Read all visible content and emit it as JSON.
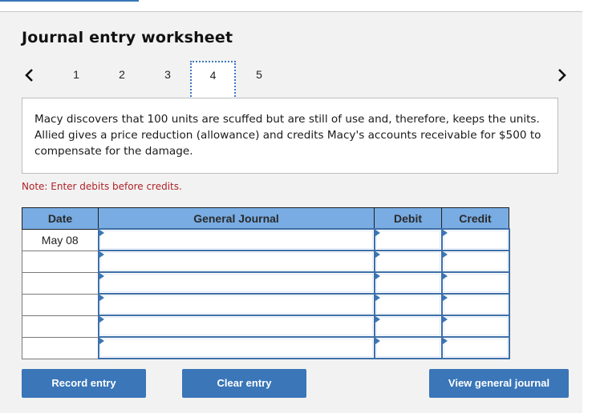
{
  "worksheet": {
    "title": "Journal entry worksheet",
    "pager": {
      "pages": [
        "1",
        "2",
        "3",
        "4",
        "5"
      ],
      "active_page": "4",
      "prev_icon": "chevron-left-icon",
      "next_icon": "chevron-right-icon"
    },
    "description": "Macy discovers that 100 units are scuffed but are still of use and, therefore, keeps the units. Allied gives a price reduction (allowance) and credits Macy's accounts receivable for $500 to compensate for the damage.",
    "note": "Note: Enter debits before credits."
  },
  "journal": {
    "headers": {
      "date": "Date",
      "general_journal": "General Journal",
      "debit": "Debit",
      "credit": "Credit"
    },
    "rows": [
      {
        "date": "May 08",
        "account": "",
        "debit": "",
        "credit": ""
      },
      {
        "date": "",
        "account": "",
        "debit": "",
        "credit": ""
      },
      {
        "date": "",
        "account": "",
        "debit": "",
        "credit": ""
      },
      {
        "date": "",
        "account": "",
        "debit": "",
        "credit": ""
      },
      {
        "date": "",
        "account": "",
        "debit": "",
        "credit": ""
      },
      {
        "date": "",
        "account": "",
        "debit": "",
        "credit": ""
      }
    ]
  },
  "buttons": {
    "record": "Record entry",
    "clear": "Clear entry",
    "view": "View general journal"
  },
  "colors": {
    "accent": "#3a76b8",
    "header_bg": "#78ace3",
    "note": "#b0232a",
    "panel_bg": "#f2f2f2"
  }
}
